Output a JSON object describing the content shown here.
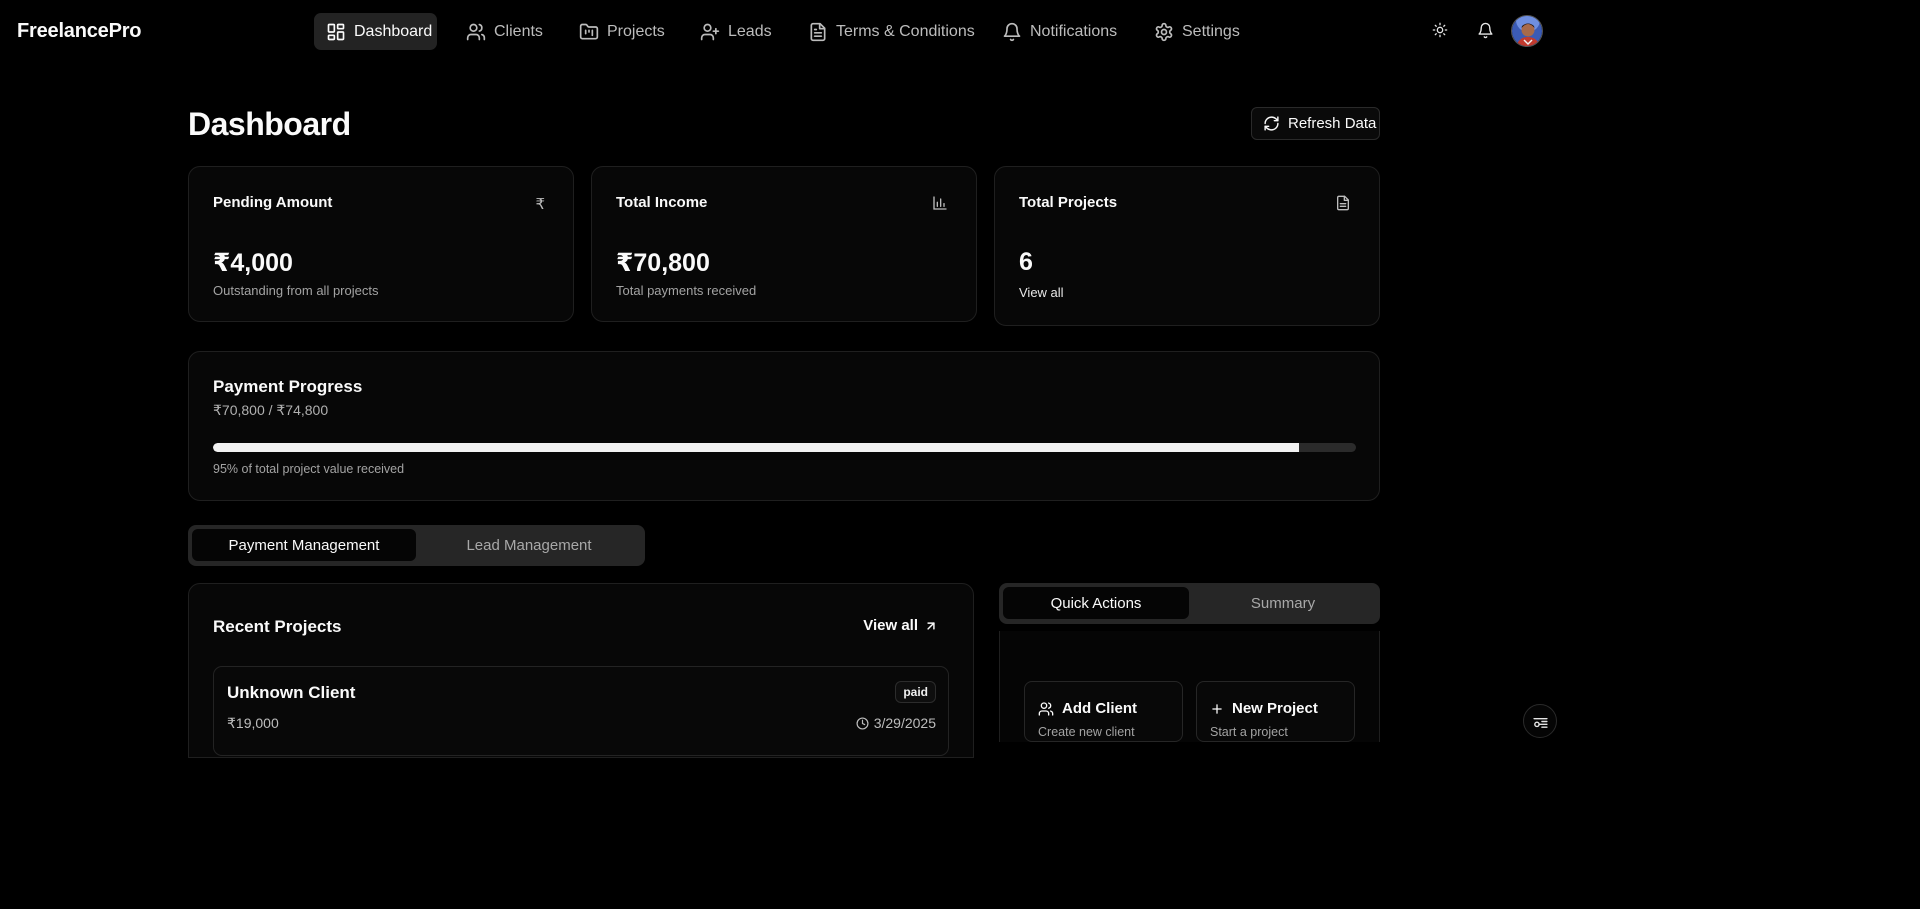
{
  "app": {
    "brand": "FreelancePro"
  },
  "nav": {
    "items": [
      {
        "label": "Dashboard",
        "icon": "dashboard-icon",
        "active": true
      },
      {
        "label": "Clients",
        "icon": "users-icon"
      },
      {
        "label": "Projects",
        "icon": "folder-kanban-icon"
      },
      {
        "label": "Leads",
        "icon": "user-plus-icon"
      },
      {
        "label": "Terms & Conditions",
        "icon": "file-text-icon"
      },
      {
        "label": "Notifications",
        "icon": "bell-icon"
      },
      {
        "label": "Settings",
        "icon": "gear-icon"
      }
    ]
  },
  "header": {
    "title": "Dashboard",
    "refresh_label": "Refresh Data"
  },
  "stats": {
    "pending": {
      "title": "Pending Amount",
      "icon": "₹",
      "value": "₹4,000",
      "sub": "Outstanding from all projects"
    },
    "income": {
      "title": "Total Income",
      "value": "₹70,800",
      "sub": "Total payments received"
    },
    "projects": {
      "title": "Total Projects",
      "value": "6",
      "link": "View all"
    }
  },
  "progress": {
    "title": "Payment Progress",
    "amount": "₹70,800 / ₹74,800",
    "fraction": 0.95,
    "note": "95% of total project value received"
  },
  "management_tabs": {
    "payment": "Payment Management",
    "lead": "Lead Management"
  },
  "recent_projects": {
    "title": "Recent Projects",
    "view_all": "View all",
    "items": [
      {
        "client": "Unknown Client",
        "amount": "₹19,000",
        "status": "paid",
        "date": "3/29/2025"
      }
    ]
  },
  "side_tabs": {
    "quick_actions": "Quick Actions",
    "summary": "Summary"
  },
  "quick_actions": {
    "add_client": {
      "label": "Add Client",
      "sub": "Create new client"
    },
    "new_project": {
      "label": "New Project",
      "sub": "Start a project"
    }
  },
  "colors": {
    "background": "#000000",
    "card": "#070707",
    "border": "#1f1f1f",
    "progress_fill": "#f2f2f2"
  }
}
